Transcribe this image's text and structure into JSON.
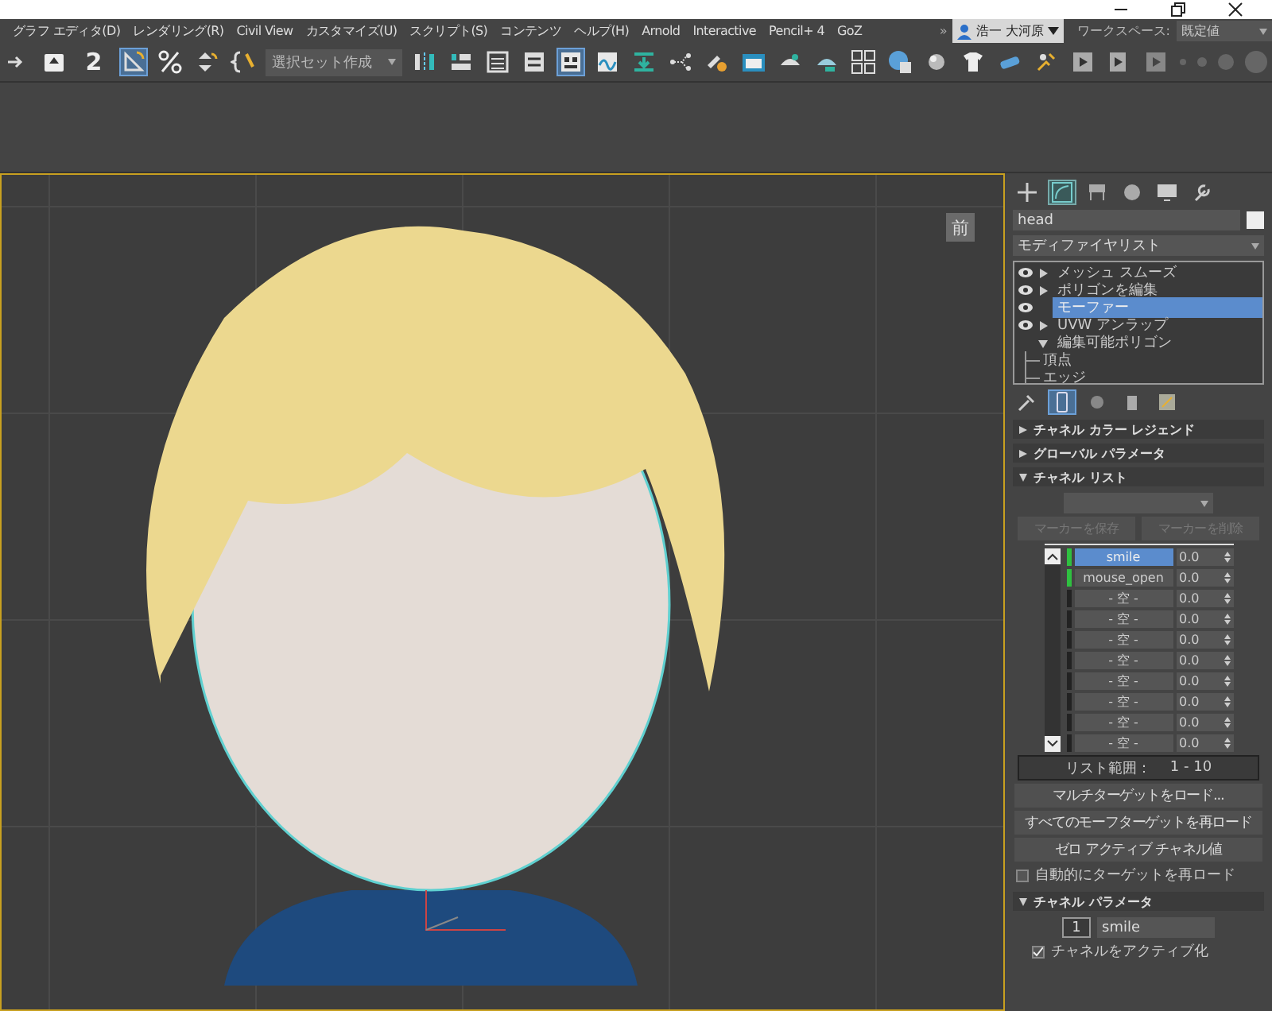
{
  "menu_bar": {
    "items": [
      "グラフ エディタ(D)",
      "レンダリング(R)",
      "Civil View",
      "カスタマイズ(U)",
      "スクリプト(S)",
      "コンテンツ",
      "ヘルプ(H)",
      "Arnold",
      "Interactive",
      "Pencil+ 4",
      "GoZ"
    ],
    "overflow": "»",
    "user": "浩一 大河原",
    "workspace_label": "ワークスペース:",
    "workspace": "既定値"
  },
  "toolbar": {
    "items": [
      {
        "kind": "icon",
        "selected": false
      },
      {
        "kind": "icon",
        "selected": false
      },
      {
        "kind": "snap",
        "label": "2",
        "selected": false
      },
      {
        "kind": "icon",
        "selected": true
      },
      {
        "kind": "icon",
        "selected": false
      },
      {
        "kind": "icon",
        "selected": false
      },
      {
        "kind": "icon",
        "selected": false
      },
      {
        "kind": "dropdown",
        "label": "選択セット作成"
      },
      {
        "kind": "icon",
        "selected": false
      },
      {
        "kind": "icon",
        "selected": false
      },
      {
        "kind": "icon",
        "selected": false
      },
      {
        "kind": "icon",
        "selected": false
      },
      {
        "kind": "icon",
        "selected": true
      },
      {
        "kind": "icon",
        "selected": false
      },
      {
        "kind": "icon",
        "selected": false
      },
      {
        "kind": "icon",
        "selected": false
      },
      {
        "kind": "icon",
        "selected": false
      },
      {
        "kind": "icon",
        "selected": false
      },
      {
        "kind": "icon",
        "selected": false
      },
      {
        "kind": "icon",
        "selected": false
      },
      {
        "kind": "icon",
        "selected": false
      },
      {
        "kind": "icon",
        "selected": false
      },
      {
        "kind": "icon",
        "selected": false
      },
      {
        "kind": "icon",
        "selected": false
      },
      {
        "kind": "icon",
        "selected": false
      },
      {
        "kind": "icon",
        "selected": false
      },
      {
        "kind": "icon",
        "selected": false
      },
      {
        "kind": "icon",
        "selected": false
      },
      {
        "kind": "icon",
        "selected": false
      }
    ]
  },
  "viewport": {
    "view_label": "前"
  },
  "command_panel": {
    "tabs": [
      {
        "selected": false
      },
      {
        "selected": true
      },
      {
        "selected": false
      },
      {
        "selected": false
      },
      {
        "selected": false
      },
      {
        "selected": false
      }
    ],
    "object_name": "head",
    "modifier_list": "モディファイヤリスト",
    "stack": [
      {
        "label": "メッシュ スムーズ",
        "visible": true,
        "expandable": true,
        "selected": false
      },
      {
        "label": "ポリゴンを編集",
        "visible": true,
        "expandable": true,
        "selected": false
      },
      {
        "label": "モーファー",
        "visible": true,
        "expandable": false,
        "selected": true
      },
      {
        "label": "UVW アンラップ",
        "visible": true,
        "expandable": true,
        "selected": false
      },
      {
        "label": "編集可能ポリゴン",
        "visible": false,
        "expandable": true,
        "selected": false,
        "children": [
          {
            "label": "頂点"
          },
          {
            "label": "エッジ"
          }
        ]
      }
    ],
    "stack_tools": [
      {
        "selected": false
      },
      {
        "selected": true
      },
      {
        "selected": false
      },
      {
        "selected": false
      },
      {
        "selected": false
      }
    ],
    "rollouts": [
      {
        "title": "チャネル カラー レジェンド",
        "expanded": false
      },
      {
        "title": "グローバル パラメータ",
        "expanded": false
      },
      {
        "kind": "channel_list",
        "title": "チャネル リスト",
        "expanded": true,
        "marker_buttons": [
          {
            "label": "マーカーを保存",
            "disabled": true
          },
          {
            "label": "マーカーを削除",
            "disabled": true
          }
        ],
        "channels": [
          {
            "name": "smile",
            "value": "0.0",
            "has_target": true,
            "selected": true
          },
          {
            "name": "mouse_open",
            "value": "0.0",
            "has_target": true,
            "selected": false
          },
          {
            "name": "- 空 -",
            "value": "0.0",
            "has_target": false,
            "selected": false
          },
          {
            "name": "- 空 -",
            "value": "0.0",
            "has_target": false,
            "selected": false
          },
          {
            "name": "- 空 -",
            "value": "0.0",
            "has_target": false,
            "selected": false
          },
          {
            "name": "- 空 -",
            "value": "0.0",
            "has_target": false,
            "selected": false
          },
          {
            "name": "- 空 -",
            "value": "0.0",
            "has_target": false,
            "selected": false
          },
          {
            "name": "- 空 -",
            "value": "0.0",
            "has_target": false,
            "selected": false
          },
          {
            "name": "- 空 -",
            "value": "0.0",
            "has_target": false,
            "selected": false
          },
          {
            "name": "- 空 -",
            "value": "0.0",
            "has_target": false,
            "selected": false
          }
        ],
        "range_label": "リスト範囲：",
        "range": "1 - 10",
        "buttons": [
          "マルチターゲットをロード...",
          "すべてのモーフターゲットを再ロード",
          "ゼロ アクティブ チャネル値"
        ],
        "auto_reload": {
          "label": "自動的にターゲットを再ロード",
          "checked": false
        }
      },
      {
        "kind": "channel_params",
        "title": "チャネル パラメータ",
        "expanded": true,
        "number": "1",
        "name": "smile",
        "active": {
          "label": "チャネルをアクティブ化",
          "checked": true
        }
      }
    ]
  }
}
